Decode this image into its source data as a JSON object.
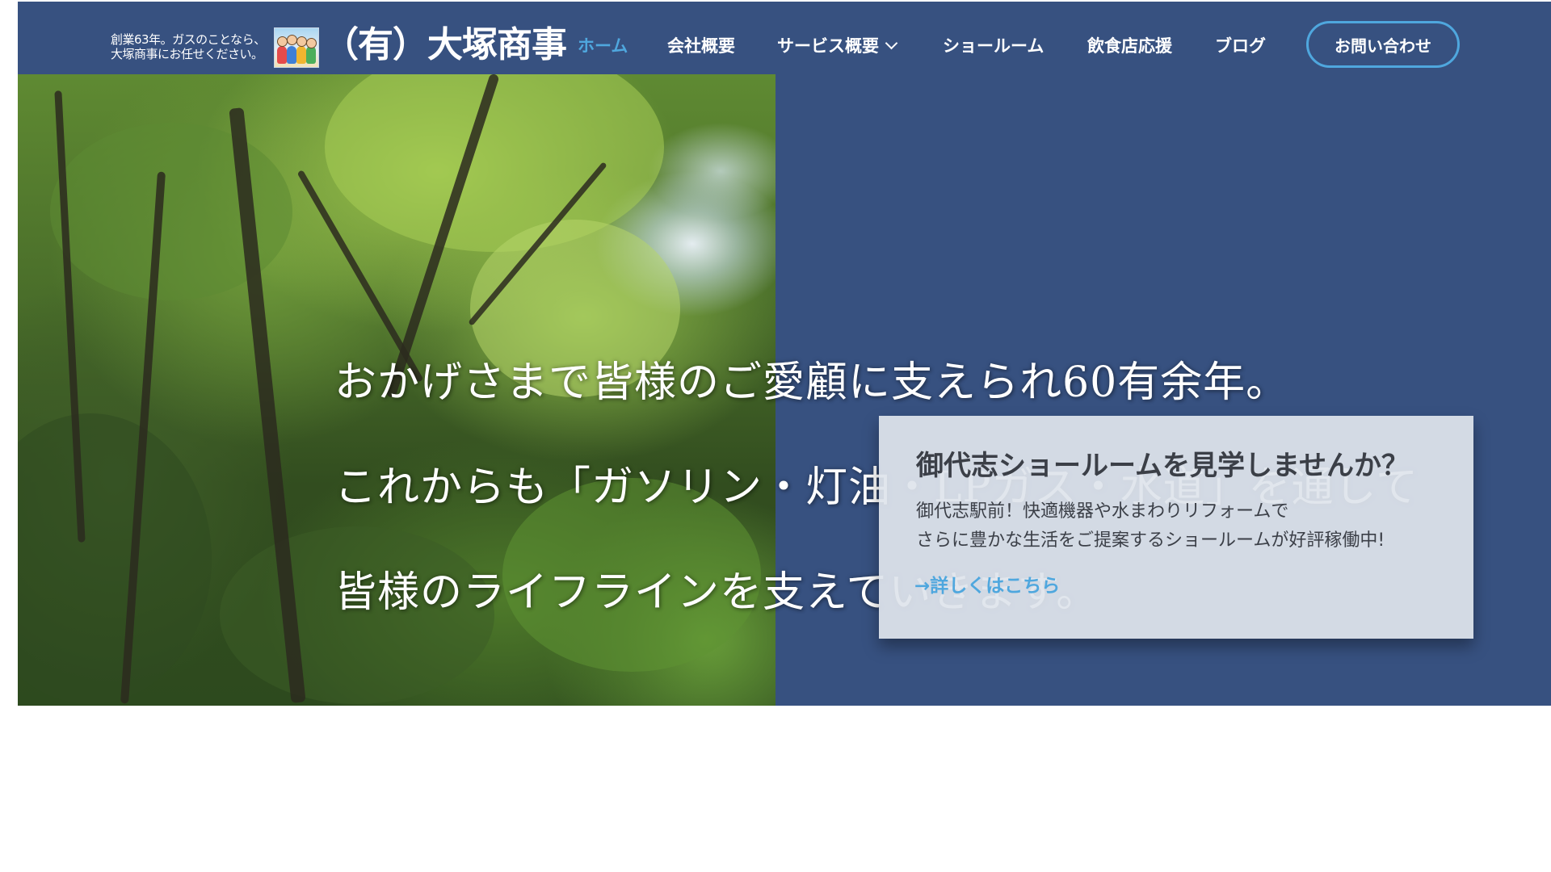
{
  "header": {
    "tagline_line1": "創業63年。ガスのことなら、",
    "tagline_line2": "大塚商事にお任せください。",
    "logo_text": "（有）大塚商事",
    "nav": [
      {
        "label": "ホーム",
        "active": true
      },
      {
        "label": "会社概要",
        "active": false
      },
      {
        "label": "サービス概要",
        "active": false,
        "has_dropdown": true
      },
      {
        "label": "ショールーム",
        "active": false
      },
      {
        "label": "飲食店応援",
        "active": false
      },
      {
        "label": "ブログ",
        "active": false
      }
    ],
    "contact_label": "お問い合わせ"
  },
  "hero": {
    "line1": "おかげさまで皆様のご愛顧に支えられ60有余年。",
    "line2": "これからも「ガソリン・灯油・LPガス・水道」を通して",
    "line3": "皆様のライフラインを支えていきます。"
  },
  "card": {
    "title": "御代志ショールームを見学しませんか？",
    "text1": "御代志駅前！快適機器や水まわりリフォームで",
    "text2": "さらに豊かな生活をご提案するショールームが好評稼働中!",
    "link": "→詳しくはこちら"
  },
  "colors": {
    "brand_blue": "#375180",
    "accent": "#4fa7de",
    "card_bg": "#dfe4ec"
  },
  "icons": {
    "mascot": "family-mascot-logo",
    "dropdown": "chevron-down-icon"
  }
}
